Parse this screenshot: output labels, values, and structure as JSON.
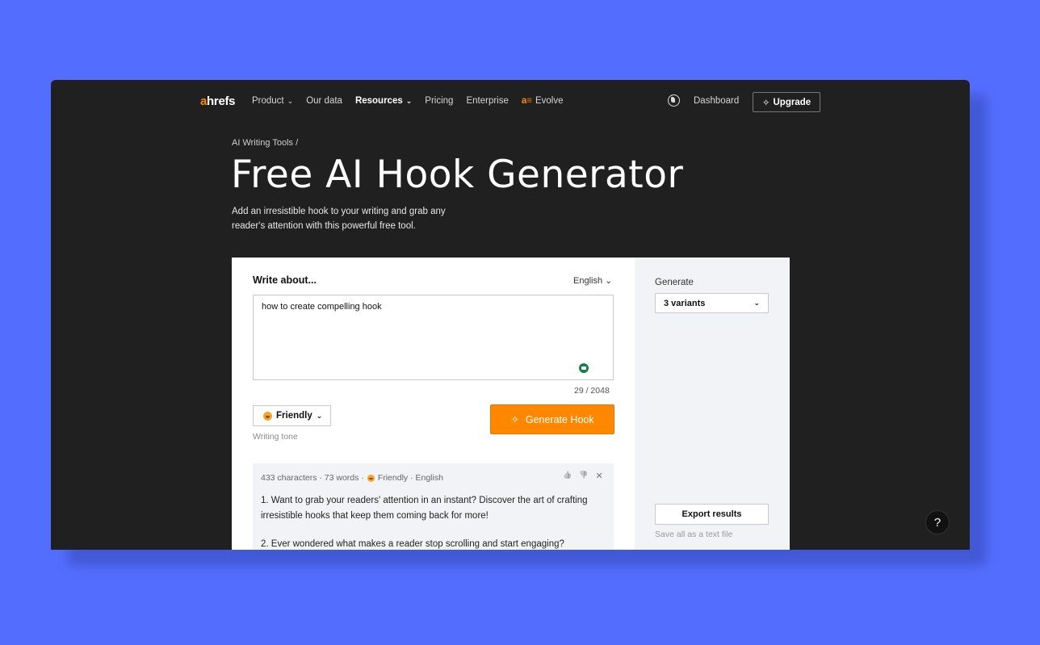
{
  "nav": {
    "logo_a": "a",
    "logo_rest": "hrefs",
    "product": "Product",
    "our_data": "Our data",
    "resources": "Resources",
    "pricing": "Pricing",
    "enterprise": "Enterprise",
    "evolve_glyph": "a≡",
    "evolve": "Evolve",
    "dashboard": "Dashboard",
    "upgrade_glyph": "✧",
    "upgrade": "Upgrade",
    "chevron": "⌄"
  },
  "hero": {
    "breadcrumb": "AI Writing Tools /",
    "title": "Free AI Hook Generator",
    "subtitle": "Add an irresistible hook to your writing and grab any reader's attention with this powerful free tool."
  },
  "form": {
    "write_label": "Write about...",
    "language": "English ⌄",
    "topic_value": "how to create compelling hook",
    "char_count": "29 / 2048",
    "tone_value": "Friendly",
    "tone_chevron": "⌄",
    "tone_label": "Writing tone",
    "generate_glyph": "✧",
    "generate_button": "Generate Hook"
  },
  "result": {
    "meta_prefix": "433 characters · 73 words ·",
    "meta_suffix": "Friendly · English",
    "like": "👍",
    "dislike": "👎",
    "close": "✕",
    "hook_1": "1. Want to grab your readers' attention in an instant? Discover the art of crafting irresistible hooks that keep them coming back for more!",
    "hook_2": "2. Ever wondered what makes a reader stop scrolling and start engaging?"
  },
  "sidebar": {
    "generate_label": "Generate",
    "variants_value": "3 variants",
    "variants_chevron": "⌄",
    "export_button": "Export results",
    "export_note": "Save all as a text file"
  },
  "help": "?",
  "icons": {
    "globe": "globe-icon",
    "sparkle": "sparkle-icon",
    "grammarly": "grammarly-icon",
    "emoji": "smile-emoji-icon"
  },
  "colors": {
    "background": "#536dfe",
    "dark": "#202020",
    "accent": "#ff8800"
  }
}
